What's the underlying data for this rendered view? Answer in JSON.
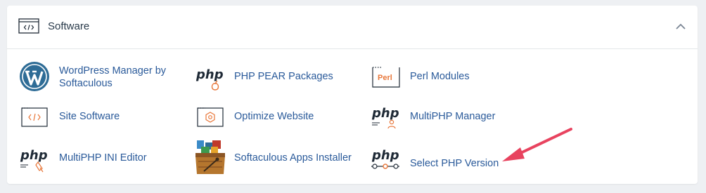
{
  "section": {
    "title": "Software",
    "header_icon": "code-window-icon",
    "collapse_icon": "chevron-up-icon"
  },
  "items": [
    {
      "label_line1": "WordPress Manager by",
      "label_line2": "Softaculous",
      "icon": "wordpress-icon"
    },
    {
      "label": "PHP PEAR Packages",
      "icon": "php-pear-icon",
      "icon_text": "php"
    },
    {
      "label": "Perl Modules",
      "icon": "perl-icon",
      "icon_text": "Perl"
    },
    {
      "label": "Site Software",
      "icon": "code-window-icon"
    },
    {
      "label": "Optimize Website",
      "icon": "gear-window-icon"
    },
    {
      "label": "MultiPHP Manager",
      "icon": "php-user-icon",
      "icon_text": "php"
    },
    {
      "label": "MultiPHP INI Editor",
      "icon": "php-editor-icon",
      "icon_text": "php"
    },
    {
      "label": "Softaculous Apps Installer",
      "icon": "softaculous-icon"
    },
    {
      "label": "Select PHP Version",
      "icon": "php-select-icon",
      "icon_text": "php"
    }
  ],
  "annotation": {
    "icon": "arrow-icon",
    "color": "#e8435f"
  },
  "colors": {
    "link": "#2a5a9a",
    "icon_dark": "#1f2a36",
    "accent": "#e8773a",
    "background": "#eef0f3",
    "panel": "#ffffff"
  }
}
